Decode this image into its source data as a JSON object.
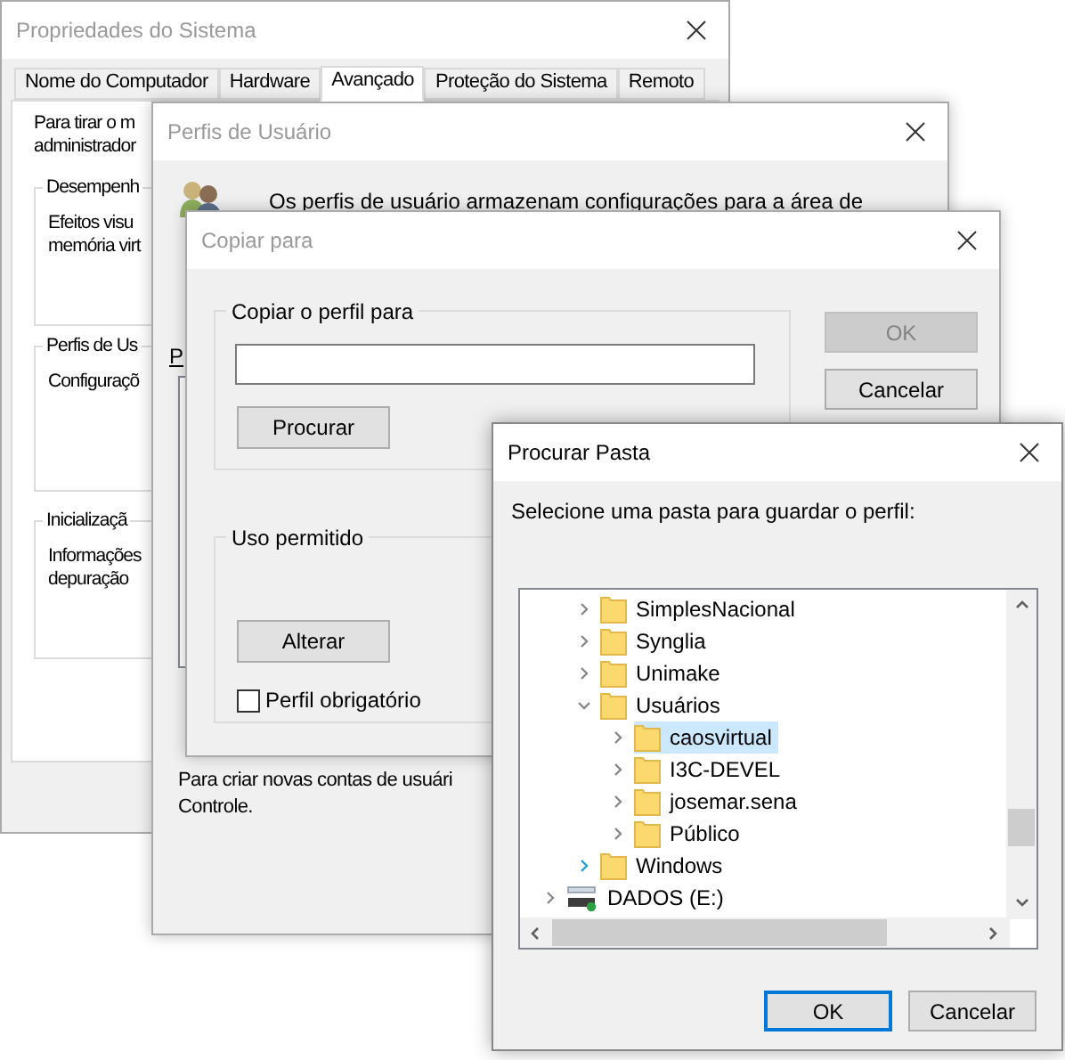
{
  "system_properties": {
    "title": "Propriedades do Sistema",
    "active": false,
    "tabs": [
      {
        "label": "Nome do Computador",
        "selected": false
      },
      {
        "label": "Hardware",
        "selected": false
      },
      {
        "label": "Avançado",
        "selected": true
      },
      {
        "label": "Proteção do Sistema",
        "selected": false
      },
      {
        "label": "Remoto",
        "selected": false
      }
    ],
    "intro": [
      "Para tirar o m",
      "administrador"
    ],
    "groups": [
      {
        "title": "Desempenh",
        "lines": [
          "Efeitos visu",
          "memória virt"
        ]
      },
      {
        "title": "Perfis de Us",
        "lines": [
          "Configuraçõ"
        ]
      },
      {
        "title": "Inicializaçã",
        "lines": [
          "Informações",
          "depuração"
        ]
      }
    ]
  },
  "user_profiles": {
    "title": "Perfis de Usuário",
    "active": false,
    "description": "Os perfis de usuário armazenam configurações para a área de",
    "list_label": "P",
    "footer": [
      "Para criar novas contas de usuári",
      "Controle."
    ]
  },
  "copy_to": {
    "title": "Copiar para",
    "active": false,
    "copy_group": {
      "title": "Copiar o perfil para",
      "browse": "Procurar"
    },
    "permitted_group": {
      "title": "Uso permitido",
      "change": "Alterar",
      "mandatory": {
        "label": "Perfil obrigatório",
        "checked": false
      }
    },
    "ok": {
      "label": "OK",
      "disabled": true
    },
    "cancel": "Cancelar"
  },
  "browse_folder": {
    "title": "Procurar Pasta",
    "active": true,
    "prompt": "Selecione uma pasta para guardar o perfil:",
    "tree": [
      {
        "kind": "drive",
        "expanded": true,
        "children": [
          {
            "kind": "folder",
            "label": "SimplesNacional",
            "expanded": false,
            "selected": false,
            "hovered": false
          },
          {
            "kind": "folder",
            "label": "Synglia",
            "expanded": false,
            "selected": false,
            "hovered": false
          },
          {
            "kind": "folder",
            "label": "Unimake",
            "expanded": false,
            "selected": false,
            "hovered": false
          },
          {
            "kind": "folder",
            "label": "Usuários",
            "expanded": true,
            "selected": false,
            "hovered": false,
            "children": [
              {
                "kind": "folder",
                "label": "caosvirtual",
                "expanded": false,
                "selected": true,
                "hovered": false
              },
              {
                "kind": "folder",
                "label": "I3C-DEVEL",
                "expanded": false,
                "selected": false,
                "hovered": false
              },
              {
                "kind": "folder",
                "label": "josemar.sena",
                "expanded": false,
                "selected": false,
                "hovered": false
              },
              {
                "kind": "folder",
                "label": "Público",
                "expanded": false,
                "selected": false,
                "hovered": false
              }
            ]
          },
          {
            "kind": "folder",
            "label": "Windows",
            "expanded": false,
            "selected": false,
            "hovered": true
          }
        ]
      },
      {
        "kind": "drive",
        "label": "DADOS (E:)",
        "expanded": false,
        "selected": false,
        "hovered": false
      }
    ],
    "ok": {
      "label": "OK",
      "default": true
    },
    "cancel": "Cancelar"
  }
}
